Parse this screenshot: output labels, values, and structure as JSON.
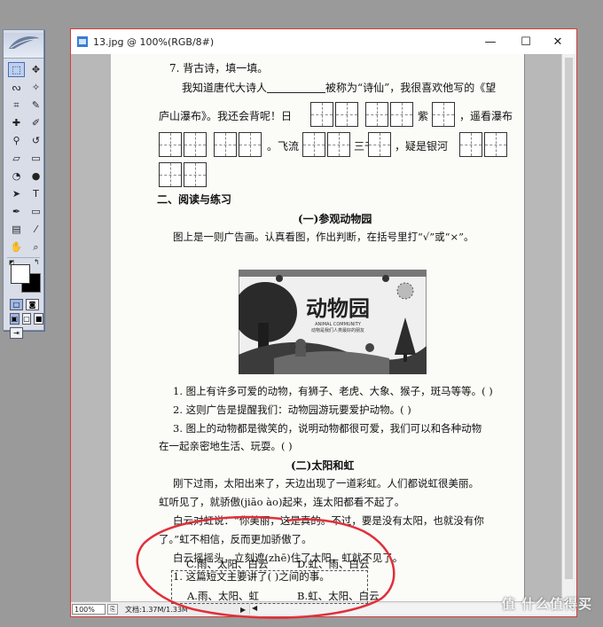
{
  "toolbox": {
    "tools": [
      {
        "name": "marquee",
        "glyph": "⬚",
        "active": true
      },
      {
        "name": "move",
        "glyph": "✥"
      },
      {
        "name": "lasso",
        "glyph": "ᔓ"
      },
      {
        "name": "magic-wand",
        "glyph": "✧"
      },
      {
        "name": "crop",
        "glyph": "⌗"
      },
      {
        "name": "slice",
        "glyph": "✎"
      },
      {
        "name": "healing-brush",
        "glyph": "✚"
      },
      {
        "name": "brush",
        "glyph": "✐"
      },
      {
        "name": "clone-stamp",
        "glyph": "⚲"
      },
      {
        "name": "history-brush",
        "glyph": "↺"
      },
      {
        "name": "eraser",
        "glyph": "▱"
      },
      {
        "name": "gradient",
        "glyph": "▭"
      },
      {
        "name": "blur",
        "glyph": "◔"
      },
      {
        "name": "dodge",
        "glyph": "●"
      },
      {
        "name": "path-selection",
        "glyph": "➤"
      },
      {
        "name": "type",
        "glyph": "T"
      },
      {
        "name": "pen",
        "glyph": "✒"
      },
      {
        "name": "shape",
        "glyph": "▭"
      },
      {
        "name": "notes",
        "glyph": "▤"
      },
      {
        "name": "eyedropper",
        "glyph": "⁄"
      },
      {
        "name": "hand",
        "glyph": "✋"
      },
      {
        "name": "zoom",
        "glyph": "⌕"
      }
    ],
    "fg_color": "#ffffff",
    "bg_color": "#000000"
  },
  "window": {
    "title": "13.jpg @ 100%(RGB/8#)",
    "min_label": "—",
    "max_label": "☐",
    "close_label": "✕"
  },
  "status": {
    "zoom": "100%",
    "doc_size": "文档:1.37M/1.33M",
    "arrow": "▶",
    "scroll_arrow": "◀"
  },
  "page": {
    "q7_title": "7. 背古诗，填一填。",
    "q7_line1_a": "我知道唐代大诗人",
    "q7_line1_b": "被称为“诗仙”，我很喜欢他写的《望",
    "q7_line2_a": "庐山瀑布》。我还会背呢！日",
    "q7_line2_b": "紫",
    "q7_line2_c": "，遥看瀑布",
    "q7_line3_a": "。飞流",
    "q7_line3_b": "三千",
    "q7_line3_c": "，疑是银河",
    "section2": "二、阅读与练习",
    "part1_title": "(一)参观动物园",
    "part1_intro": "图上是一则广告画。认真看图，作出判断，在括号里打“√”或“×”。",
    "poster_title": "动物园",
    "poster_sub1": "ANIMAL COMMUNITY",
    "poster_sub2": "动物是我们人类最好的朋友",
    "p1_q1": "1. 图上有许多可爱的动物，有狮子、老虎、大象、猴子，斑马等等。(    )",
    "p1_q2": "2. 这则广告是提醒我们：动物园游玩要爱护动物。(    )",
    "p1_q3a": "3. 图上的动物都是微笑的，说明动物都很可爱，我们可以和各种动物",
    "p1_q3b": "在一起亲密地生活、玩耍。(    )",
    "part2_title": "(二)太阳和虹",
    "p2_l1": "刚下过雨，太阳出来了，天边出现了一道彩虹。人们都说虹很美丽。",
    "p2_l2": "虹听见了，就骄傲(jiāo ào)起来，连太阳都看不起了。",
    "p2_l3": "白云对虹说：“你美丽，这是真的。不过，要是没有太阳，也就没有你",
    "p2_l4": "了。”虹不相信，反而更加骄傲了。",
    "p2_l5": "白云摇摇头，立刻遮(zhē)住了太阳，虹就不见了。",
    "p2_q1": "1. 这篇短文主要讲了(    )之间的事。",
    "opt_a": "A.雨、太阳、虹",
    "opt_b": "B.虹、太阳、白云",
    "opt_c": "C.雨、太阳、白云",
    "opt_d": "D.虹、雨、白云"
  },
  "watermark": "值 什么值得买",
  "colors": {
    "annotation_red": "#e0303a",
    "window_border": "#d33b3b"
  }
}
